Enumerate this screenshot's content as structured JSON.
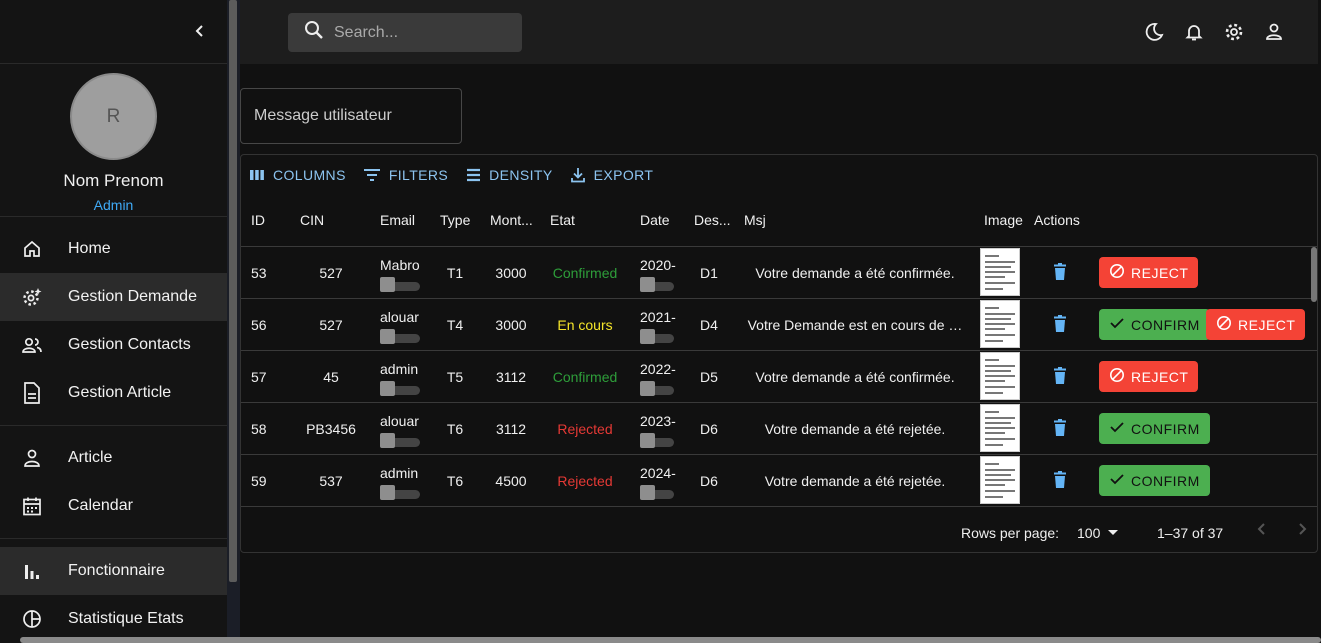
{
  "sidebar": {
    "profile": {
      "initial": "R",
      "name": "Nom Prenom",
      "role": "Admin"
    },
    "groups": [
      [
        {
          "label": "Home",
          "icon": "home-icon"
        },
        {
          "label": "Gestion Demande",
          "icon": "gear-sparkle-icon",
          "active": true
        },
        {
          "label": "Gestion Contacts",
          "icon": "people-icon"
        },
        {
          "label": "Gestion Article",
          "icon": "document-icon"
        }
      ],
      [
        {
          "label": "Article",
          "icon": "person-icon"
        },
        {
          "label": "Calendar",
          "icon": "calendar-icon"
        }
      ],
      [
        {
          "label": "Fonctionnaire",
          "icon": "bar-chart-icon",
          "active": true
        },
        {
          "label": "Statistique Etats",
          "icon": "pie-chart-icon"
        }
      ]
    ]
  },
  "topbar": {
    "search_placeholder": "Search..."
  },
  "main": {
    "message_placeholder": "Message utilisateur",
    "toolbar": {
      "columns": "COLUMNS",
      "filters": "FILTERS",
      "density": "DENSITY",
      "export": "EXPORT"
    },
    "columns": [
      "ID",
      "CIN",
      "Email",
      "Type",
      "Mont...",
      "Etat",
      "Date",
      "Des...",
      "Msj",
      "Image",
      "Actions"
    ],
    "rows": [
      {
        "id": "53",
        "cin": "527",
        "email": "Mabro",
        "type": "T1",
        "montant": "3000",
        "etat": "Confirmed",
        "etat_color": "#2e9e3a",
        "date": "2020-",
        "des": "D1",
        "msj": "Votre demande a été confirmée.",
        "actions": [
          "reject"
        ]
      },
      {
        "id": "56",
        "cin": "527",
        "email": "alouar",
        "type": "T4",
        "montant": "3000",
        "etat": "En cours",
        "etat_color": "#f5e52a",
        "date": "2021-",
        "des": "D4",
        "msj": "Votre Demande est en cours de …",
        "actions": [
          "confirm",
          "reject"
        ]
      },
      {
        "id": "57",
        "cin": "45",
        "email": "admin",
        "type": "T5",
        "montant": "3112",
        "etat": "Confirmed",
        "etat_color": "#2e9e3a",
        "date": "2022-",
        "des": "D5",
        "msj": "Votre demande a été confirmée.",
        "actions": [
          "reject"
        ]
      },
      {
        "id": "58",
        "cin": "PB3456",
        "email": "alouar",
        "type": "T6",
        "montant": "3112",
        "etat": "Rejected",
        "etat_color": "#e53935",
        "date": "2023-",
        "des": "D6",
        "msj": "Votre demande a été rejetée.",
        "actions": [
          "confirm"
        ]
      },
      {
        "id": "59",
        "cin": "537",
        "email": "admin",
        "type": "T6",
        "montant": "4500",
        "etat": "Rejected",
        "etat_color": "#e53935",
        "date": "2024-",
        "des": "D6",
        "msj": "Votre demande a été rejetée.",
        "actions": [
          "confirm"
        ]
      }
    ],
    "labels": {
      "confirm": "CONFIRM",
      "reject": "REJECT"
    },
    "footer": {
      "rows_per_page_label": "Rows per page:",
      "rows_per_page": "100",
      "range": "1–37 of 37"
    }
  }
}
